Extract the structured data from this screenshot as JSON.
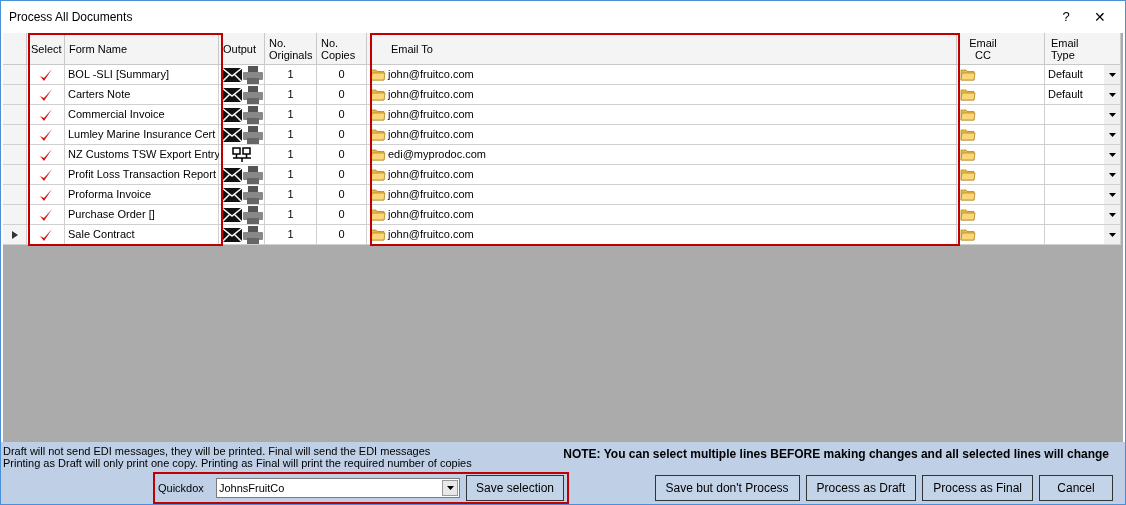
{
  "window": {
    "title": "Process All Documents",
    "help": "?",
    "close": "✕"
  },
  "columns": [
    {
      "label": "Select"
    },
    {
      "label": "Form Name"
    },
    {
      "label": "Output"
    },
    {
      "label": "No. Originals"
    },
    {
      "label": "No. Copies"
    },
    {
      "label": "Email To"
    },
    {
      "label": "Email CC"
    },
    {
      "label": "Email Type"
    }
  ],
  "rows": [
    {
      "checked": true,
      "current": false,
      "form_name": "BOL -SLI [Summary]",
      "kind": "email_print",
      "originals": "1",
      "copies": "0",
      "email_to": "john@fruitco.com",
      "email_type": "Default"
    },
    {
      "checked": true,
      "current": false,
      "form_name": "Carters Note",
      "kind": "email_print",
      "originals": "1",
      "copies": "0",
      "email_to": "john@fruitco.com",
      "email_type": "Default"
    },
    {
      "checked": true,
      "current": false,
      "form_name": "Commercial Invoice",
      "kind": "email_print",
      "originals": "1",
      "copies": "0",
      "email_to": "john@fruitco.com"
    },
    {
      "checked": true,
      "current": false,
      "form_name": "Lumley Marine Insurance Cert",
      "kind": "email_print",
      "originals": "1",
      "copies": "0",
      "email_to": "john@fruitco.com"
    },
    {
      "checked": true,
      "current": false,
      "form_name": "NZ Customs TSW Export Entry",
      "kind": "edi",
      "originals": "1",
      "copies": "0",
      "email_to": "edi@myprodoc.com"
    },
    {
      "checked": true,
      "current": false,
      "form_name": "Profit Loss Transaction Report",
      "kind": "email_print",
      "originals": "1",
      "copies": "0",
      "email_to": "john@fruitco.com"
    },
    {
      "checked": true,
      "current": false,
      "form_name": "Proforma Invoice",
      "kind": "email_print",
      "originals": "1",
      "copies": "0",
      "email_to": "john@fruitco.com"
    },
    {
      "checked": true,
      "current": false,
      "form_name": "Purchase Order []",
      "kind": "email_print",
      "originals": "1",
      "copies": "0",
      "email_to": "john@fruitco.com"
    },
    {
      "checked": true,
      "current": true,
      "form_name": "Sale Contract",
      "kind": "email_print",
      "originals": "1",
      "copies": "0",
      "email_to": "john@fruitco.com"
    }
  ],
  "info_lines": [
    "Draft will not send EDI messages, they will be printed.  Final will send the EDI messages",
    "Printing as Draft will only print one copy.  Printing as Final will print the required number of copies"
  ],
  "note": "NOTE:  You can select multiple lines BEFORE making changes and all selected lines will change",
  "quickdox": {
    "label": "Quickdox",
    "value": "JohnsFruitCo",
    "save_button": "Save selection"
  },
  "buttons": [
    "Save but don't Process",
    "Process as Draft",
    "Process as Final",
    "Cancel"
  ]
}
